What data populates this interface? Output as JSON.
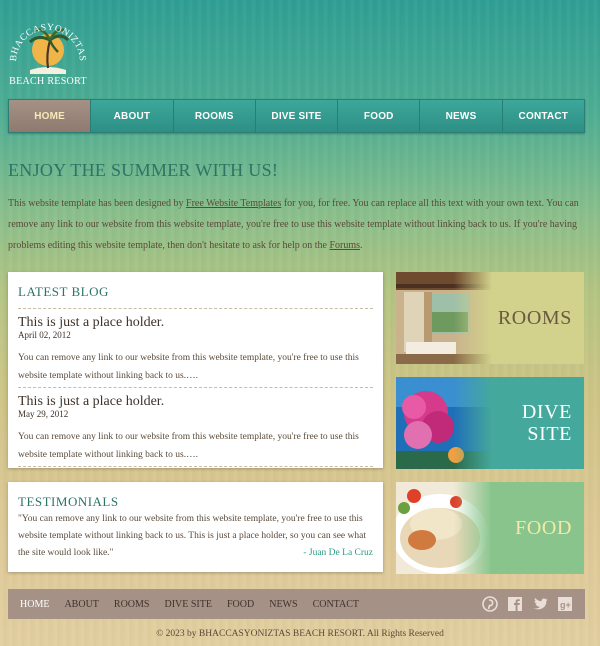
{
  "brand": {
    "arc_text": "BHACCASYONIZTAS",
    "sub_text": "BEACH RESORT"
  },
  "nav": {
    "items": [
      {
        "label": "HOME"
      },
      {
        "label": "ABOUT"
      },
      {
        "label": "ROOMS"
      },
      {
        "label": "DIVE SITE"
      },
      {
        "label": "FOOD"
      },
      {
        "label": "NEWS"
      },
      {
        "label": "CONTACT"
      }
    ],
    "active_color": "#a69187",
    "bar_color": "#3da79b"
  },
  "main": {
    "headline": "ENJOY THE SUMMER WITH US!",
    "intro": {
      "part1": "This website template has been designed by ",
      "link1": "Free Website Templates",
      "part2": " for you, for free. You can replace all this text with your own text. You can remove any link to our website from this website template, you're free to use this website template without linking back to us. If you're having problems editing this website template, then don't hesitate to ask for help on the ",
      "link2": "Forums",
      "part3": "."
    }
  },
  "blog": {
    "title": "LATEST BLOG",
    "posts": [
      {
        "title": "This is just a place holder.",
        "date": "April 02, 2012",
        "body": "You can remove any link to our website from this website template, you're free to use this website template without linking back to us.…."
      },
      {
        "title": "This is just a place holder.",
        "date": "May 29, 2012",
        "body": "You can remove any link to our website from this website template, you're free to use this website template without linking back to us.…."
      }
    ]
  },
  "testimonials": {
    "title": "TESTIMONIALS",
    "quote": "\"You can remove any link to our website from this website template, you're free to use this website template without linking back to us. This is just a place holder, so you can see what the site would look like.\"",
    "author": "- Juan De La Cruz"
  },
  "cards": {
    "rooms": {
      "label": "ROOMS",
      "color": "#d2d28c"
    },
    "dive": {
      "label_line1": "DIVE",
      "label_line2": "SITE",
      "color": "#45a89c"
    },
    "food": {
      "label": "FOOD",
      "color": "#88c48c"
    }
  },
  "footer": {
    "links": [
      {
        "label": "HOME"
      },
      {
        "label": "ABOUT"
      },
      {
        "label": "ROOMS"
      },
      {
        "label": "DIVE SITE"
      },
      {
        "label": "FOOD"
      },
      {
        "label": "NEWS"
      },
      {
        "label": "CONTACT"
      }
    ],
    "social_icons": [
      "pinterest-icon",
      "facebook-icon",
      "twitter-icon",
      "googleplus-icon"
    ],
    "copyright": "© 2023 by BHACCASYONIZTAS BEACH RESORT. All Rights Reserved"
  }
}
